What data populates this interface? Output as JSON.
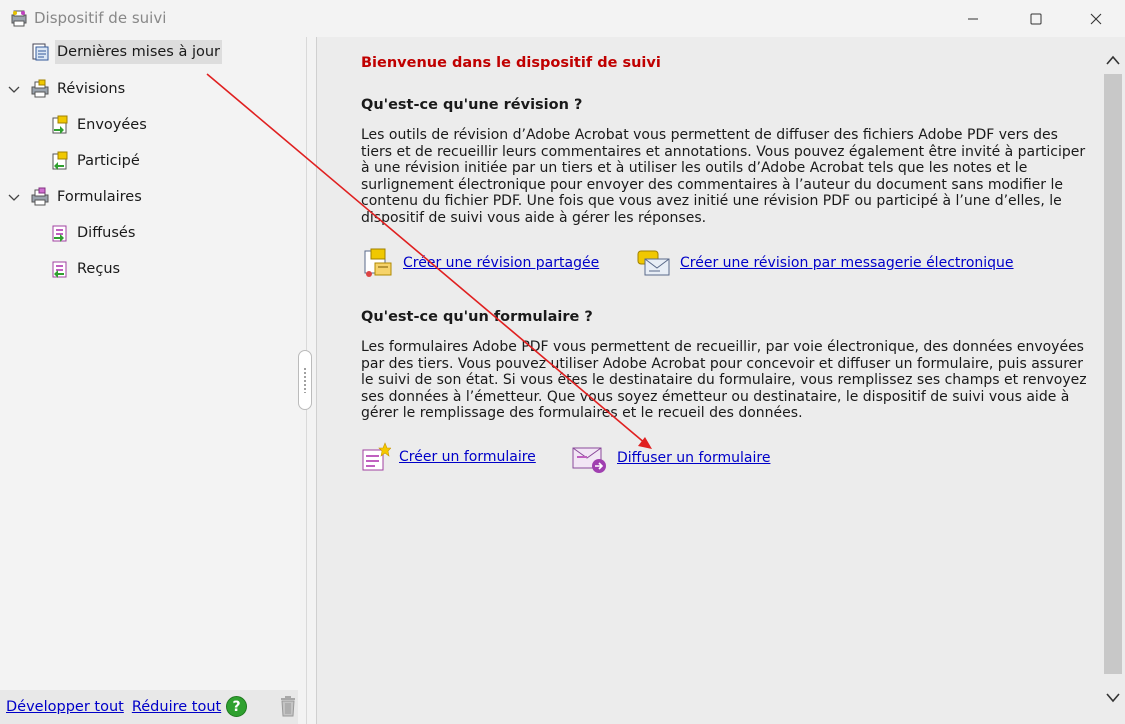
{
  "window": {
    "title": "Dispositif de suivi",
    "icons": {
      "app": "tracker-icon",
      "minimize": "minimize-icon",
      "maximize": "maximize-icon",
      "close": "close-icon"
    }
  },
  "sidebar": {
    "items": [
      {
        "label": "Dernières mises à jour",
        "icon": "updates-icon",
        "selected": true
      },
      {
        "label": "Révisions",
        "icon": "reviews-icon",
        "expanded": true
      },
      {
        "label": "Envoyées",
        "icon": "sent-review-icon"
      },
      {
        "label": "Participé",
        "icon": "joined-review-icon"
      },
      {
        "label": "Formulaires",
        "icon": "forms-icon",
        "expanded": true
      },
      {
        "label": "Diffusés",
        "icon": "distributed-form-icon"
      },
      {
        "label": "Reçus",
        "icon": "received-form-icon"
      }
    ],
    "footer": {
      "expand_all": "Développer tout",
      "collapse_all": "Réduire tout",
      "help_label": "?"
    }
  },
  "main": {
    "welcome": "Bienvenue dans le dispositif de suivi",
    "review_heading": "Qu'est-ce qu'une révision ?",
    "review_text": "Les outils de révision d’Adobe Acrobat vous permettent de diffuser des fichiers Adobe PDF vers des tiers et de recueillir leurs commentaires et annotations. Vous pouvez également être invité à participer à une révision initiée par un tiers et à utiliser les outils d’Adobe Acrobat tels que les notes et le surlignement électronique pour envoyer des commentaires à l’auteur du document sans modifier le contenu du fichier PDF. Une fois que vous avez initié une révision PDF ou participé à l’une d’elles, le dispositif de suivi vous aide à gérer les réponses.",
    "shared_review_link": "Créer une révision partagée",
    "email_review_link": "Créer une révision par messagerie électronique",
    "form_heading": "Qu'est-ce qu'un formulaire ?",
    "form_text": "Les formulaires Adobe PDF vous permettent de recueillir, par voie électronique, des données envoyées par des tiers. Vous pouvez utiliser Adobe Acrobat pour concevoir et diffuser un formulaire, puis assurer le suivi de son état. Si vous êtes le destinataire du formulaire, vous remplissez ses champs et renvoyez ses données à l’émetteur. Que vous soyez émetteur ou destinataire, le dispositif de suivi vous aide à gérer le remplissage des formulaires et le recueil des données.",
    "create_form_link": "Créer un formulaire",
    "distribute_form_link": "Diffuser un formulaire"
  },
  "colors": {
    "welcome": "#c00000",
    "link": "#0000c8",
    "annotation_arrow": "#e02020",
    "help": "#2fa12f"
  }
}
